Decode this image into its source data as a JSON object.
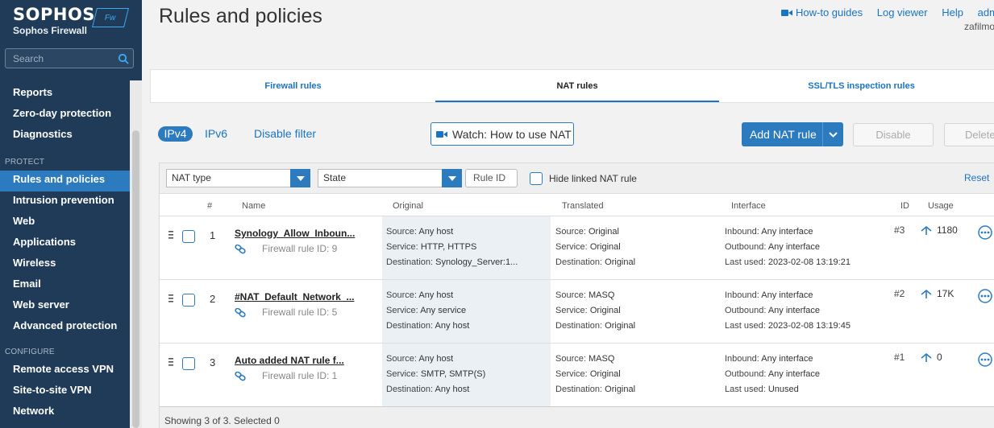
{
  "brand": {
    "name": "SOPHOS",
    "product": "Sophos Firewall",
    "badge": "Fw"
  },
  "search": {
    "placeholder": "Search"
  },
  "nav": {
    "items_top": [
      "Reports",
      "Zero-day protection",
      "Diagnostics"
    ],
    "section_protect": "PROTECT",
    "items_protect": [
      "Rules and policies",
      "Intrusion prevention",
      "Web",
      "Applications",
      "Wireless",
      "Email",
      "Web server",
      "Advanced protection"
    ],
    "section_configure": "CONFIGURE",
    "items_configure": [
      "Remote access VPN",
      "Site-to-site VPN",
      "Network"
    ],
    "active": "Rules and policies"
  },
  "header": {
    "title": "Rules and policies",
    "how_to": "How-to guides",
    "log_viewer": "Log viewer",
    "help": "Help",
    "admin": "admin",
    "user": "zafilmo"
  },
  "tabs": [
    "Firewall rules",
    "NAT rules",
    "SSL/TLS inspection rules"
  ],
  "toolbar": {
    "ipv4": "IPv4",
    "ipv6": "IPv6",
    "disable_filter": "Disable filter",
    "watch": "Watch: How to use NAT",
    "add": "Add NAT rule",
    "disable": "Disable",
    "delete": "Delete"
  },
  "filters": {
    "nat_type": "NAT type",
    "state": "State",
    "rule_id": "Rule ID",
    "hide_linked": "Hide linked NAT rule",
    "reset": "Reset"
  },
  "columns": {
    "num": "#",
    "name": "Name",
    "original": "Original",
    "translated": "Translated",
    "interface": "Interface",
    "id": "ID",
    "usage": "Usage"
  },
  "rows": [
    {
      "num": "1",
      "name": "Synology_Allow_Inboun...",
      "sub": "Firewall rule ID: 9",
      "orig_src": "Any host",
      "orig_svc": "HTTP, HTTPS",
      "orig_dst": "Synology_Server:1...",
      "tr_src": "Original",
      "tr_svc": "Original",
      "tr_dst": "Original",
      "inbound": "Any interface",
      "outbound": "Any interface",
      "last_used": "2023-02-08 13:19:21",
      "id": "#3",
      "usage": "1180"
    },
    {
      "num": "2",
      "name": "#NAT_Default_Network_...",
      "sub": "Firewall rule ID: 5",
      "orig_src": "Any host",
      "orig_svc": "Any service",
      "orig_dst": "Any host",
      "tr_src": "MASQ",
      "tr_svc": "Original",
      "tr_dst": "Original",
      "inbound": "Any interface",
      "outbound": "Any interface",
      "last_used": "2023-02-08 13:19:45",
      "id": "#2",
      "usage": "17K"
    },
    {
      "num": "3",
      "name": "Auto added NAT rule f...",
      "sub": "Firewall rule ID: 1",
      "orig_src": "Any host",
      "orig_svc": "SMTP, SMTP(S)",
      "orig_dst": "Any host",
      "tr_src": "MASQ",
      "tr_svc": "Original",
      "tr_dst": "Original",
      "inbound": "Any interface",
      "outbound": "Any interface",
      "last_used": "Unused",
      "id": "#1",
      "usage": "0"
    }
  ],
  "labels": {
    "source": "Source:",
    "service": "Service:",
    "destination": "Destination:",
    "inbound": "Inbound:",
    "outbound": "Outbound:",
    "last_used": "Last used:"
  },
  "footer": {
    "status": "Showing 3 of 3. Selected 0"
  }
}
